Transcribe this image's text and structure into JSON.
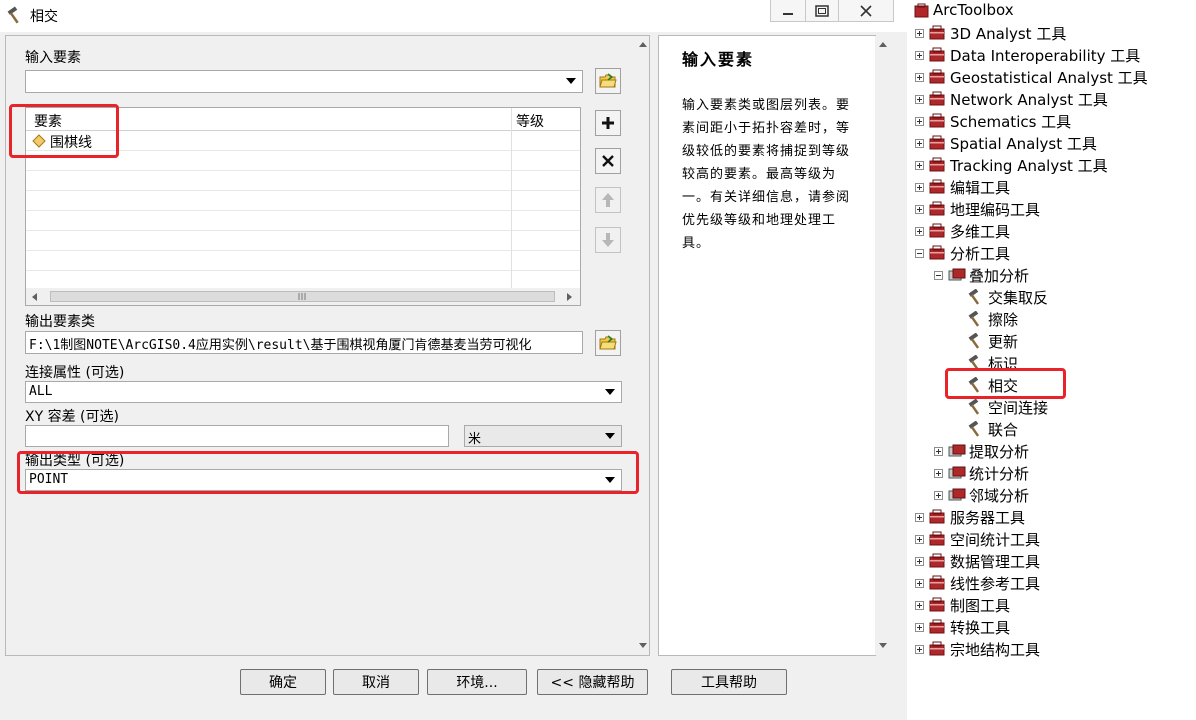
{
  "window": {
    "title": "相交",
    "buttons": [
      "minimize",
      "restore",
      "close"
    ]
  },
  "form": {
    "input_features_label": "输入要素",
    "input_features_value": "",
    "grid": {
      "col_feature": "要素",
      "col_rank": "等级",
      "rows": [
        {
          "feature": "围棋线",
          "rank": ""
        }
      ]
    },
    "output_label": "输出要素类",
    "output_value": "F:\\1制图NOTE\\ArcGIS0.4应用实例\\result\\基于围棋视角厦门肯德基麦当劳可视化",
    "join_label": "连接属性 (可选)",
    "join_value": "ALL",
    "xy_label": "XY 容差 (可选)",
    "xy_value": "",
    "xy_unit": "米",
    "outtype_label": "输出类型 (可选)",
    "outtype_value": "POINT"
  },
  "buttons": {
    "ok": "确定",
    "cancel": "取消",
    "env": "环境...",
    "hide_help": "<< 隐藏帮助",
    "tool_help": "工具帮助"
  },
  "help": {
    "title": "输入要素",
    "body": "输入要素类或图层列表。要素间距小于拓扑容差时，等级较低的要素将捕捉到等级较高的要素。最高等级为一。有关详细信息，请参阅优先级等级和地理处理工具。"
  },
  "toolbox": {
    "root": "ArcToolbox",
    "items": [
      {
        "label": "3D Analyst 工具"
      },
      {
        "label": "Data Interoperability 工具"
      },
      {
        "label": "Geostatistical Analyst 工具"
      },
      {
        "label": "Network Analyst 工具"
      },
      {
        "label": "Schematics 工具"
      },
      {
        "label": "Spatial Analyst 工具"
      },
      {
        "label": "Tracking Analyst 工具"
      },
      {
        "label": "编辑工具"
      },
      {
        "label": "地理编码工具"
      },
      {
        "label": "多维工具"
      },
      {
        "label": "分析工具"
      },
      {
        "label": "叠加分析"
      },
      {
        "label": "交集取反"
      },
      {
        "label": "擦除"
      },
      {
        "label": "更新"
      },
      {
        "label": "标识"
      },
      {
        "label": "相交"
      },
      {
        "label": "空间连接"
      },
      {
        "label": "联合"
      },
      {
        "label": "提取分析"
      },
      {
        "label": "统计分析"
      },
      {
        "label": "邻域分析"
      },
      {
        "label": "服务器工具"
      },
      {
        "label": "空间统计工具"
      },
      {
        "label": "数据管理工具"
      },
      {
        "label": "线性参考工具"
      },
      {
        "label": "制图工具"
      },
      {
        "label": "转换工具"
      },
      {
        "label": "宗地结构工具"
      }
    ]
  },
  "colors": {
    "highlight": "#e8242a",
    "toolbox_red": "#b0272a"
  }
}
